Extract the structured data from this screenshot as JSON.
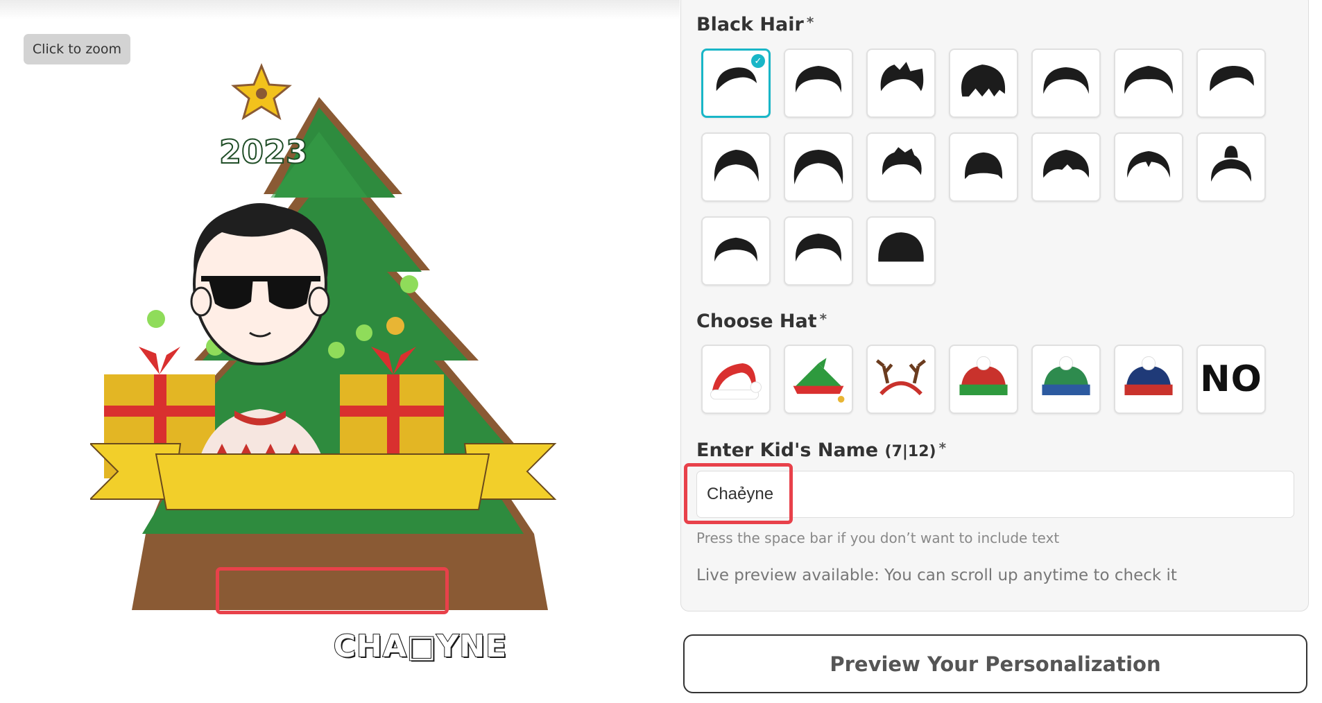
{
  "zoom_button_label": "Click to zoom",
  "preview": {
    "year": "2023",
    "name_on_banner": "CHA□YNE"
  },
  "hair_section": {
    "title": "Black Hair",
    "required_mark": "*",
    "options": [
      {
        "style": "swept-side",
        "selected": true
      },
      {
        "style": "curly-top",
        "selected": false
      },
      {
        "style": "spiky-quiff",
        "selected": false
      },
      {
        "style": "twists",
        "selected": false
      },
      {
        "style": "wavy",
        "selected": false
      },
      {
        "style": "curly-mop",
        "selected": false
      },
      {
        "style": "side-swoop",
        "selected": false
      },
      {
        "style": "pompadour",
        "selected": false
      },
      {
        "style": "curly-long",
        "selected": false
      },
      {
        "style": "spiky-short",
        "selected": false
      },
      {
        "style": "buzz-cap",
        "selected": false
      },
      {
        "style": "messy-fringe",
        "selected": false
      },
      {
        "style": "middle-part",
        "selected": false
      },
      {
        "style": "top-bun",
        "selected": false
      },
      {
        "style": "flat-top",
        "selected": false
      },
      {
        "style": "dreadlocks",
        "selected": false
      },
      {
        "style": "bowl-cut",
        "selected": false
      }
    ]
  },
  "hat_section": {
    "title": "Choose Hat",
    "required_mark": "*",
    "options": [
      {
        "icon": "santa-hat-icon"
      },
      {
        "icon": "elf-hat-icon"
      },
      {
        "icon": "reindeer-antlers-icon"
      },
      {
        "icon": "red-green-beanie-icon"
      },
      {
        "icon": "green-blue-beanie-icon"
      },
      {
        "icon": "navy-red-beanie-icon"
      },
      {
        "icon": "no-hat-option",
        "label": "NO"
      }
    ]
  },
  "name_section": {
    "title": "Enter Kid's Name",
    "count": "(7|12)",
    "required_mark": "*",
    "value": "Chaẻyne",
    "hint": "Press the space bar if you don’t want to include text",
    "live_preview_note": "Live preview available: You can scroll up anytime to check it"
  },
  "preview_button_label": "Preview Your Personalization",
  "colors": {
    "selected_border": "#19b6c7",
    "highlight_box": "#e8414a",
    "tree_green": "#2e8b3e",
    "banner_yellow": "#f2cf2a"
  }
}
